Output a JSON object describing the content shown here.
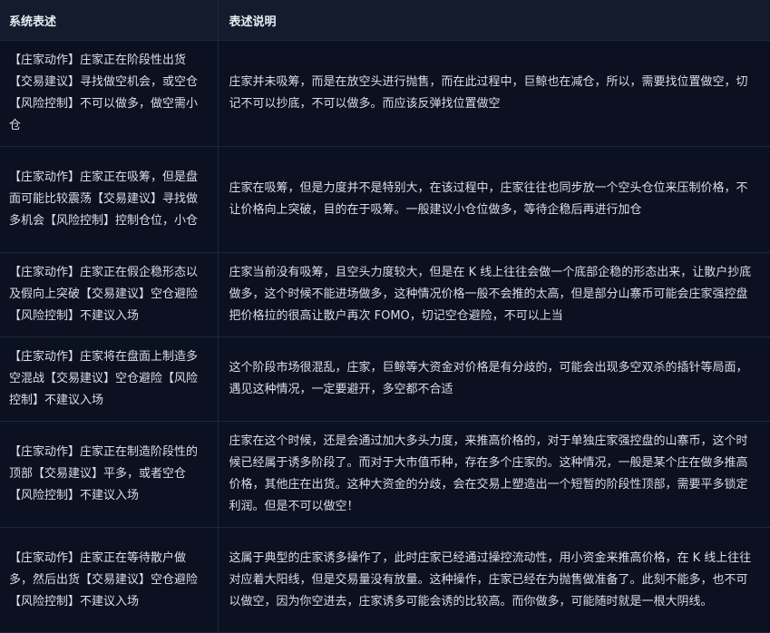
{
  "header": {
    "col1": "系统表述",
    "col2": "表述说明"
  },
  "rows": [
    {
      "system": "【庄家动作】庄家正在阶段性出货【交易建议】寻找做空机会，或空仓【风险控制】不可以做多，做空需小仓",
      "explanation": "庄家并未吸筹，而是在放空头进行抛售，而在此过程中，巨鲸也在减仓，所以，需要找位置做空，切记不可以抄底，不可以做多。而应该反弹找位置做空"
    },
    {
      "system": "【庄家动作】庄家正在吸筹，但是盘面可能比较震荡【交易建议】寻找做多机会【风险控制】控制仓位，小仓",
      "explanation": "庄家在吸筹，但是力度并不是特别大，在该过程中，庄家往往也同步放一个空头仓位来压制价格，不让价格向上突破，目的在于吸筹。一般建议小仓位做多，等待企稳后再进行加仓"
    },
    {
      "system": "【庄家动作】庄家正在假企稳形态以及假向上突破【交易建议】空仓避险【风险控制】不建议入场",
      "explanation": "庄家当前没有吸筹，且空头力度较大，但是在 K 线上往往会做一个底部企稳的形态出来，让散户抄底做多，这个时候不能进场做多，这种情况价格一般不会推的太高，但是部分山寨币可能会庄家强控盘把价格拉的很高让散户再次 FOMO，切记空仓避险，不可以上当"
    },
    {
      "system": "【庄家动作】庄家将在盘面上制造多空混战【交易建议】空仓避险【风险控制】不建议入场",
      "explanation": "这个阶段市场很混乱，庄家，巨鲸等大资金对价格是有分歧的，可能会出现多空双杀的插针等局面，遇见这种情况，一定要避开，多空都不合适"
    },
    {
      "system": "【庄家动作】庄家正在制造阶段性的顶部【交易建议】平多，或者空仓【风险控制】不建议入场",
      "explanation": "庄家在这个时候，还是会通过加大多头力度，来推高价格的，对于单独庄家强控盘的山寨币，这个时候已经属于诱多阶段了。而对于大市值币种，存在多个庄家的。这种情况，一般是某个庄在做多推高价格，其他庄在出货。这种大资金的分歧，会在交易上塑造出一个短暂的阶段性顶部，需要平多锁定利润。但是不可以做空！"
    },
    {
      "system": "【庄家动作】庄家正在等待散户做多，然后出货【交易建议】空仓避险【风险控制】不建议入场",
      "explanation": "这属于典型的庄家诱多操作了，此时庄家已经通过操控流动性，用小资金来推高价格，在 K 线上往往对应着大阳线，但是交易量没有放量。这种操作，庄家已经在为抛售做准备了。此刻不能多，也不可以做空，因为你空进去，庄家诱多可能会诱的比较高。而你做多，可能随时就是一根大阴线。"
    }
  ]
}
